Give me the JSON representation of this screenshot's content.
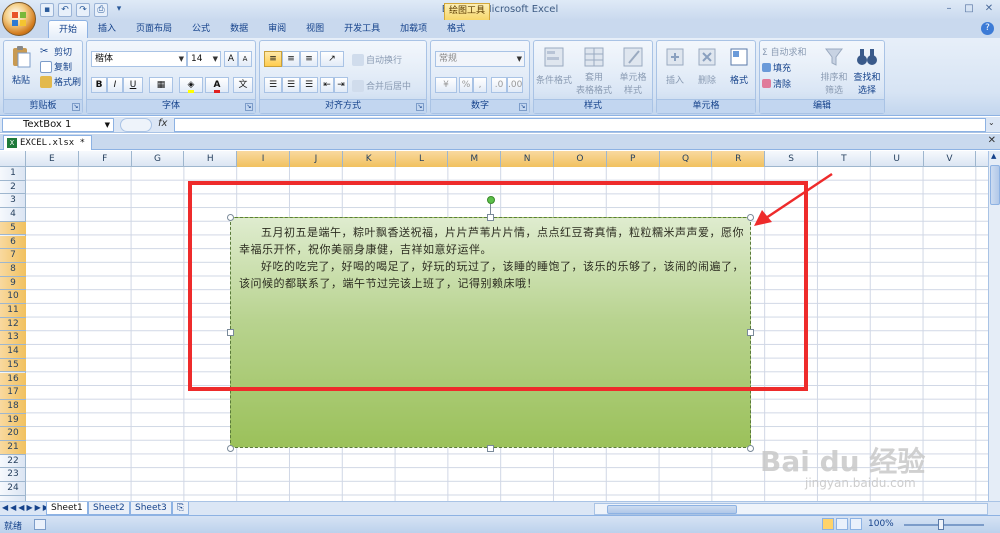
{
  "app": {
    "title": "EXCEL - Microsoft Excel",
    "context_tab_group": "绘图工具",
    "window_controls": [
      "–",
      "□",
      "✕"
    ]
  },
  "qat": {
    "save": "▪",
    "undo": "↶",
    "redo": "↷",
    "preview": "⎙",
    "more": "▾"
  },
  "ribbon_tabs": [
    "开始",
    "插入",
    "页面布局",
    "公式",
    "数据",
    "审阅",
    "视图",
    "开发工具",
    "加载项",
    "格式"
  ],
  "active_tab": "开始",
  "clipboard": {
    "paste": "粘贴",
    "cut": "剪切",
    "copy": "复制",
    "format_painter": "格式刷",
    "label": "剪贴板"
  },
  "font": {
    "name": "楷体",
    "size": "14",
    "label": "字体",
    "bold": "B",
    "italic": "I",
    "underline": "U",
    "grow": "A",
    "shrink": "A"
  },
  "alignment": {
    "label": "对齐方式",
    "wrap": "自动换行",
    "merge": "合并后居中"
  },
  "number": {
    "format": "常规",
    "label": "数字",
    "percent": "%",
    "comma": ","
  },
  "styles": {
    "conditional": "条件格式",
    "table": "套用",
    "table2": "表格格式",
    "cell": "单元格",
    "cell2": "样式",
    "label": "样式"
  },
  "cells": {
    "insert": "插入",
    "delete": "删除",
    "format": "格式",
    "label": "单元格"
  },
  "editing": {
    "autosum": "Σ 自动求和",
    "fill": "填充",
    "clear": "清除",
    "sort": "排序和",
    "sort2": "筛选",
    "find": "查找和",
    "find2": "选择",
    "label": "编辑"
  },
  "formula_bar": {
    "name_box": "TextBox 1",
    "fx": "fx",
    "value": ""
  },
  "document_tab": {
    "name": "EXCEL.xlsx *"
  },
  "columns": [
    "E",
    "F",
    "G",
    "H",
    "I",
    "J",
    "K",
    "L",
    "M",
    "N",
    "O",
    "P",
    "Q",
    "R",
    "S",
    "T",
    "U",
    "V"
  ],
  "selected_columns": [
    "I",
    "J",
    "K",
    "L",
    "M",
    "N",
    "O",
    "P",
    "Q",
    "R"
  ],
  "rows": [
    "1",
    "2",
    "3",
    "4",
    "5",
    "6",
    "7",
    "8",
    "9",
    "10",
    "11",
    "12",
    "13",
    "14",
    "15",
    "16",
    "17",
    "18",
    "19",
    "20",
    "21",
    "22",
    "23",
    "24"
  ],
  "selected_rows": [
    "5",
    "6",
    "7",
    "8",
    "9",
    "10",
    "11",
    "12",
    "13",
    "14",
    "15",
    "16",
    "17",
    "18",
    "19",
    "20",
    "21"
  ],
  "textbox": {
    "para1": "五月初五是端午，粽叶飘香送祝福，片片芦苇片片情，点点红豆寄真情，粒粒糯米声声爱，愿你幸福乐开怀，祝你美丽身康健，吉祥如意好运伴。",
    "para2": "好吃的吃完了，好喝的喝足了，好玩的玩过了，该睡的睡饱了，该乐的乐够了，该闹的闹遍了，该问候的都联系了，端午节过完该上班了，记得别赖床哦！"
  },
  "sheets": [
    "Sheet1",
    "Sheet2",
    "Sheet3"
  ],
  "active_sheet": "Sheet1",
  "status": {
    "mode": "就绪",
    "zoom": "100%"
  },
  "watermark": {
    "logo": "Bai du 经验",
    "url": "jingyan.baidu.com"
  },
  "colors": {
    "annotation": "#ee2b2b",
    "textbox_top": "#dfeccf",
    "textbox_bottom": "#9bc15a"
  }
}
